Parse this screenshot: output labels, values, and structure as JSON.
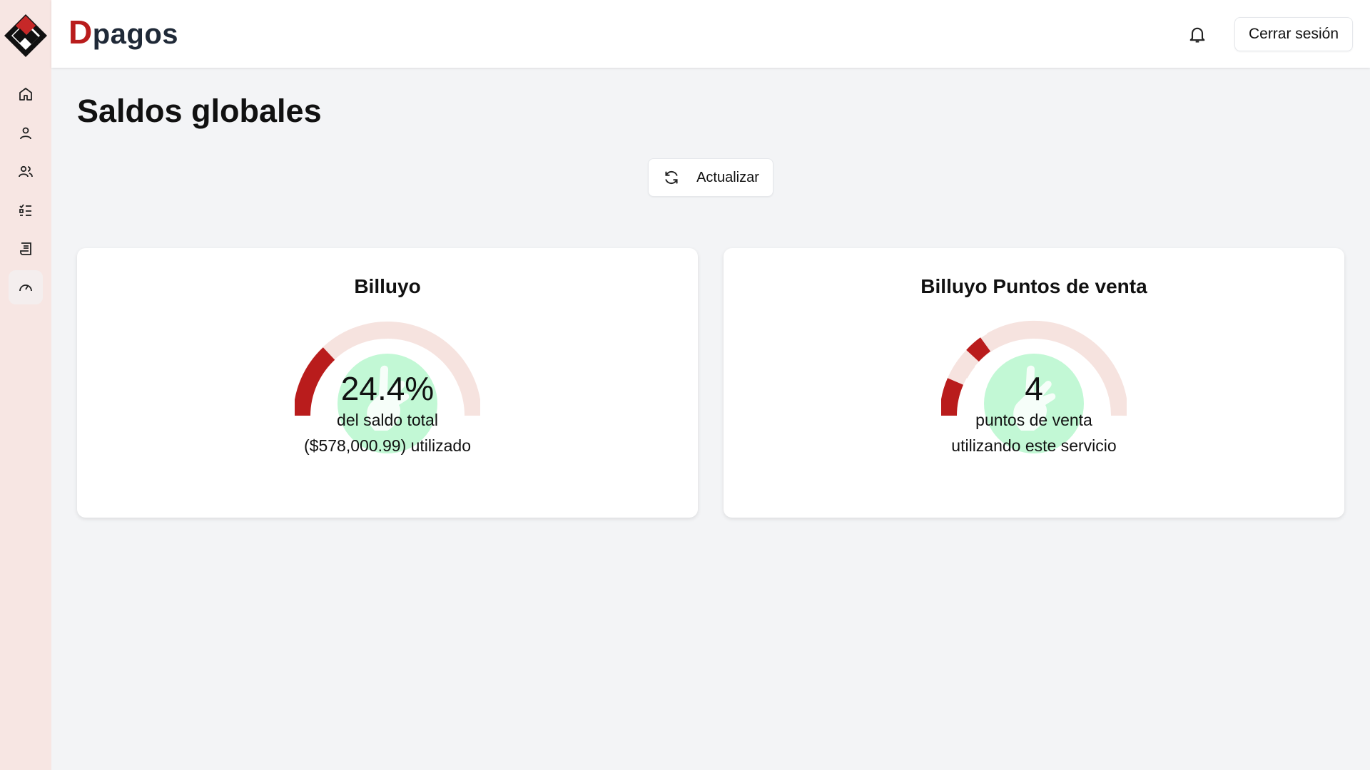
{
  "brand": {
    "first": "D",
    "rest": "pagos"
  },
  "header": {
    "logout_label": "Cerrar sesión",
    "notification_icon": "bell-icon"
  },
  "sidebar": {
    "items": [
      {
        "icon": "home-icon",
        "active": false
      },
      {
        "icon": "user-icon",
        "active": false
      },
      {
        "icon": "users-icon",
        "active": false
      },
      {
        "icon": "checklist-icon",
        "active": false
      },
      {
        "icon": "receipt-icon",
        "active": false
      },
      {
        "icon": "gauge-icon",
        "active": true
      }
    ]
  },
  "page": {
    "title": "Saldos globales"
  },
  "actions": {
    "refresh_label": "Actualizar",
    "refresh_icon": "refresh-icon"
  },
  "colors": {
    "accent": "#b91c1c",
    "gauge_track": "#f6e3df",
    "hand": "#bbf7d0"
  },
  "cards": [
    {
      "title": "Billuyo",
      "value": "24.4%",
      "line1": "del saldo total",
      "line2": "($578,000.99) utilizado",
      "fill_percent": 24.4
    },
    {
      "title": "Billuyo Puntos de venta",
      "value": "4",
      "line1": "puntos de venta",
      "line2": "utilizando este servicio"
    }
  ]
}
